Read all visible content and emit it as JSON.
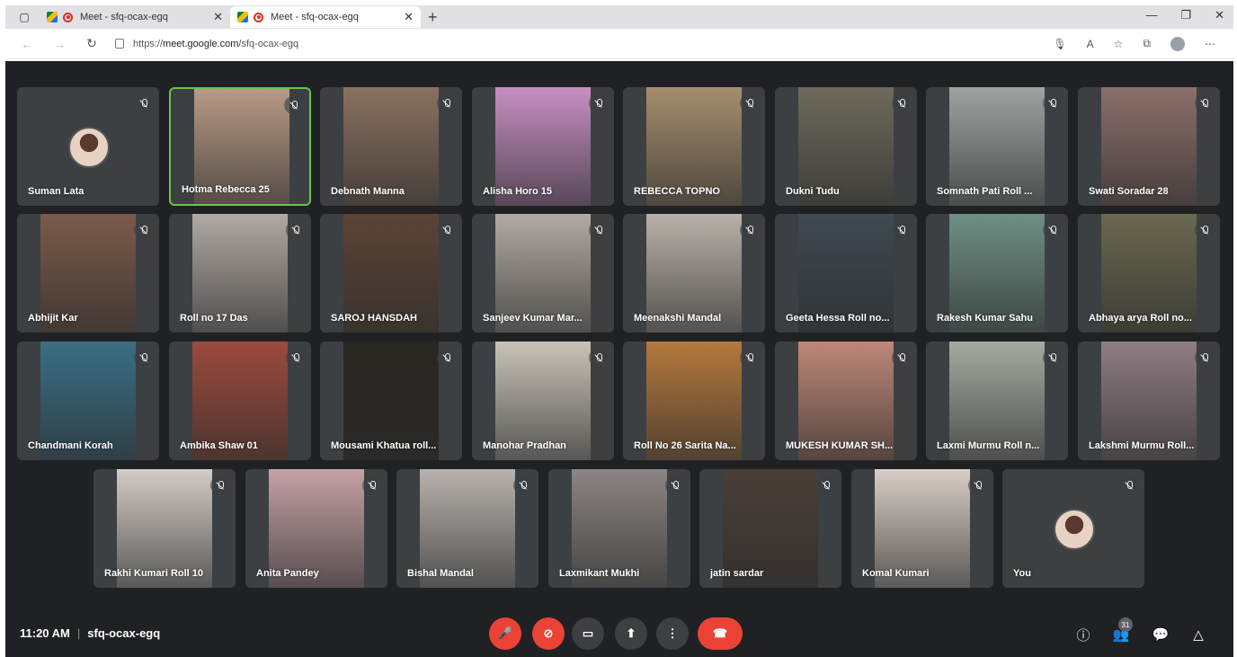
{
  "browser": {
    "tabs": [
      {
        "title": "Meet - sfq-ocax-egq"
      },
      {
        "title": "Meet - sfq-ocax-egq"
      }
    ],
    "url_prefix": "https://",
    "url_host": "meet.google.com",
    "url_path": "/sfq-ocax-egq"
  },
  "participants": [
    {
      "name": "Suman Lata",
      "video": false
    },
    {
      "name": "Hotma Rebecca 25",
      "video": true,
      "bg": "#b89a86"
    },
    {
      "name": "Debnath Manna",
      "video": true,
      "bg": "#8a7160"
    },
    {
      "name": "Alisha Horo 15",
      "video": true,
      "bg": "#c78fc3"
    },
    {
      "name": "REBECCA TOPNO",
      "video": true,
      "bg": "#a58e6e"
    },
    {
      "name": "Dukni Tudu",
      "video": true,
      "bg": "#6e6b5c"
    },
    {
      "name": "Somnath Pati Roll ...",
      "video": true,
      "bg": "#9ea3a1"
    },
    {
      "name": "Swati Soradar 28",
      "video": true,
      "bg": "#8b6f6a"
    },
    {
      "name": "Abhijit Kar",
      "video": true,
      "bg": "#7b5a4a"
    },
    {
      "name": "Roll no 17 Das",
      "video": true,
      "bg": "#b0a9a4"
    },
    {
      "name": "SAROJ HANSDAH",
      "video": true,
      "bg": "#5c4436"
    },
    {
      "name": "Sanjeev Kumar Mar...",
      "video": true,
      "bg": "#b2aaa3"
    },
    {
      "name": "Meenakshi Mandal",
      "video": true,
      "bg": "#b9b2aa"
    },
    {
      "name": "Geeta Hessa Roll no...",
      "video": true,
      "bg": "#3f4a52"
    },
    {
      "name": "Rakesh Kumar Sahu",
      "video": true,
      "bg": "#6f8f84"
    },
    {
      "name": "Abhaya arya Roll no...",
      "video": true,
      "bg": "#6a6850"
    },
    {
      "name": "Chandmani Korah",
      "video": true,
      "bg": "#3a6e86"
    },
    {
      "name": "Ambika Shaw 01",
      "video": true,
      "bg": "#9c4a3c"
    },
    {
      "name": "Mousami Khatua roll...",
      "video": true,
      "bg": "#2a2622"
    },
    {
      "name": "Manohar Pradhan",
      "video": true,
      "bg": "#c9c4b8"
    },
    {
      "name": "Roll No 26 Sarita Na...",
      "video": true,
      "bg": "#b5793c"
    },
    {
      "name": "MUKESH KUMAR SH...",
      "video": true,
      "bg": "#bf8777"
    },
    {
      "name": "Laxmi Murmu Roll n...",
      "video": true,
      "bg": "#a6aaa2"
    },
    {
      "name": "Lakshmi Murmu Roll...",
      "video": true,
      "bg": "#8f7d84"
    },
    {
      "name": "Rakhi Kumari Roll 10",
      "video": true,
      "bg": "#d3ccc7"
    },
    {
      "name": "Anita Pandey",
      "video": true,
      "bg": "#c6a1a6"
    },
    {
      "name": "Bishal Mandal",
      "video": true,
      "bg": "#b7b2ae"
    },
    {
      "name": "Laxmikant Mukhi",
      "video": true,
      "bg": "#8b8583"
    },
    {
      "name": "jatin sardar",
      "video": true,
      "bg": "#4b3f38"
    },
    {
      "name": "Komal Kumari",
      "video": true,
      "bg": "#d8cec6"
    },
    {
      "name": "You",
      "video": false
    }
  ],
  "bottom": {
    "time": "11:20 AM",
    "meeting_code": "sfq-ocax-egq",
    "participant_count": "31"
  },
  "colors": {
    "meet_bg": "#202124",
    "tile_bg": "#3c4043",
    "danger": "#ea4335"
  }
}
